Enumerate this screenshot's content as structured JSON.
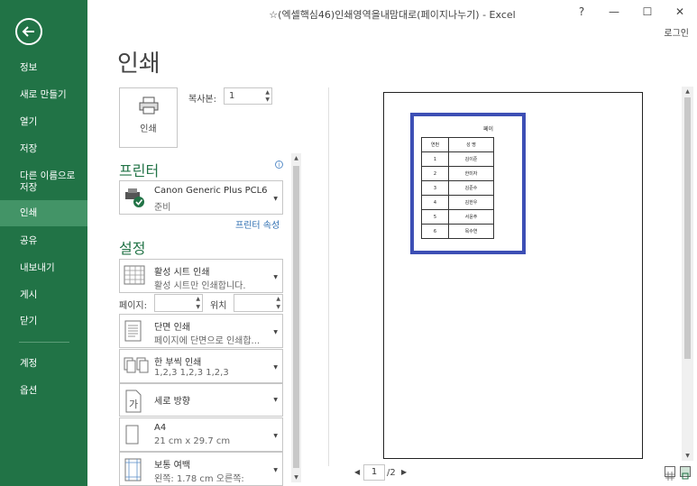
{
  "window": {
    "title": "☆(엑셀핵심46)인쇄영역을내맘대로(페이지나누기) - Excel",
    "help": "?",
    "minimize": "—",
    "restore": "☐",
    "close": "✕",
    "login": "로그인"
  },
  "sidebar": {
    "items": [
      {
        "label": "정보"
      },
      {
        "label": "새로 만들기"
      },
      {
        "label": "열기"
      },
      {
        "label": "저장"
      },
      {
        "label": "다른 이름으로"
      },
      {
        "label": "저장"
      },
      {
        "label": "인쇄"
      },
      {
        "label": "공유"
      },
      {
        "label": "내보내기"
      },
      {
        "label": "게시"
      },
      {
        "label": "닫기"
      },
      {
        "label": "계정"
      },
      {
        "label": "옵션"
      }
    ]
  },
  "page_title": "인쇄",
  "print": {
    "button_label": "인쇄",
    "copies_label": "복사본:",
    "copies_value": "1"
  },
  "printer": {
    "section": "프린터",
    "info_icon": "i",
    "name": "Canon Generic Plus PCL6",
    "status": "준비",
    "properties_link": "프린터 속성"
  },
  "settings": {
    "section": "설정",
    "what": {
      "main": "활성 시트 인쇄",
      "sub": "활성 시트만 인쇄합니다."
    },
    "pages_label": "페이지:",
    "to_label": "위치",
    "sides": {
      "main": "단면 인쇄",
      "sub": "페이지에 단면으로 인쇄합..."
    },
    "collate": {
      "main": "한 부씩 인쇄",
      "sub": "1,2,3    1,2,3    1,2,3"
    },
    "orientation": {
      "main": "세로 방향",
      "icon_text": "가"
    },
    "paper": {
      "main": "A4",
      "sub": "21 cm x 29.7 cm"
    },
    "margins": {
      "main": "보통 여백",
      "sub": "왼쪽:  1.78 cm    오른쪽:"
    }
  },
  "preview": {
    "sheet_title": "페이",
    "table": {
      "headers": [
        "연번",
        "성 명"
      ],
      "rows": [
        [
          "1",
          "김이준"
        ],
        [
          "2",
          "한미자"
        ],
        [
          "3",
          "김준수"
        ],
        [
          "4",
          "김한우"
        ],
        [
          "5",
          "서윤주"
        ],
        [
          "6",
          "목수연"
        ]
      ]
    },
    "current_page": "1",
    "total_pages": "/2"
  },
  "colors": {
    "accent": "#217346",
    "active_nav": "#439467",
    "print_area": "#3d4fb5"
  }
}
